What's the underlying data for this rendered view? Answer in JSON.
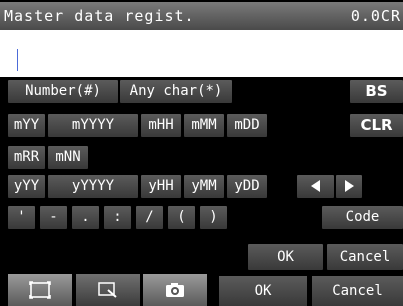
{
  "header": {
    "title": "Master data regist.",
    "value": "0.0CR"
  },
  "input": {
    "value": ""
  },
  "keyboard": {
    "number_key": "Number(#)",
    "anychar_key": "Any char(*)",
    "bs_key": "BS",
    "clr_key": "CLR",
    "code_key": "Code",
    "ok_key": "OK",
    "cancel_key": "Cancel",
    "row2": [
      "mYY",
      "mYYYY",
      "mHH",
      "mMM",
      "mDD"
    ],
    "row3": [
      "mRR",
      "mNN"
    ],
    "row4": [
      "yYY",
      "yYYYY",
      "yHH",
      "yMM",
      "yDD"
    ],
    "symbols": [
      "'",
      "-",
      ".",
      ":",
      "/",
      "(",
      ")"
    ]
  },
  "bottom": {
    "tools": [
      "frame-icon",
      "zoom-icon",
      "camera-icon"
    ],
    "ok_label": "OK",
    "cancel_label": "Cancel"
  },
  "colors": {
    "caret": "#4c6bd8",
    "key": "#4a4a4a",
    "key_light": "#d8d8d8"
  }
}
